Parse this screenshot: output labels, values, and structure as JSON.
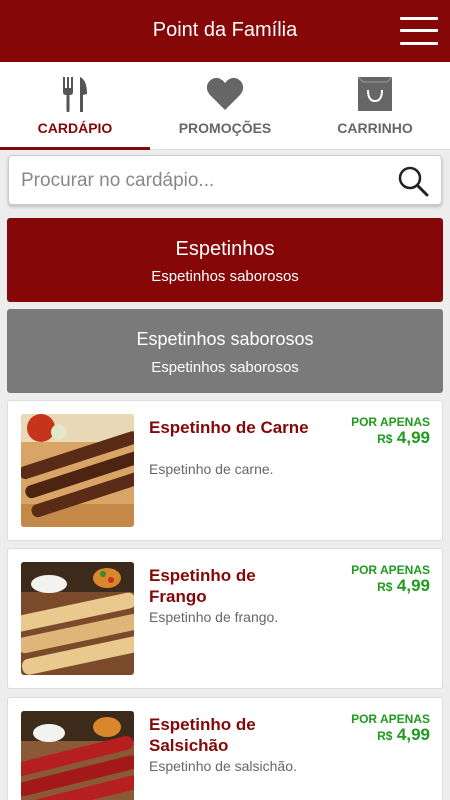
{
  "header": {
    "title": "Point da Família"
  },
  "tabs": [
    {
      "label": "CARDÁPIO",
      "icon": "fork-knife-icon",
      "active": true
    },
    {
      "label": "PROMOÇÕES",
      "icon": "heart-icon",
      "active": false
    },
    {
      "label": "CARRINHO",
      "icon": "shopping-bag-icon",
      "active": false
    }
  ],
  "search": {
    "placeholder": "Procurar no cardápio..."
  },
  "categories": [
    {
      "name": "Espetinhos",
      "description": "Espetinhos saborosos"
    },
    {
      "name": "Espetinhos saborosos",
      "description": "Espetinhos saborosos"
    }
  ],
  "items": [
    {
      "name": "Espetinho de Carne",
      "description": "Espetinho de carne.",
      "price_label": "POR APENAS",
      "currency": "R$",
      "price": "4,99"
    },
    {
      "name": "Espetinho de Frango",
      "description": "Espetinho de frango.",
      "price_label": "POR APENAS",
      "currency": "R$",
      "price": "4,99"
    },
    {
      "name": "Espetinho de Salsichão",
      "description": "Espetinho de salsichão.",
      "price_label": "POR APENAS",
      "currency": "R$",
      "price": "4,99"
    }
  ],
  "colors": {
    "brand": "#850707",
    "price": "#1f9b1f",
    "category_secondary": "#7a7a7a"
  }
}
